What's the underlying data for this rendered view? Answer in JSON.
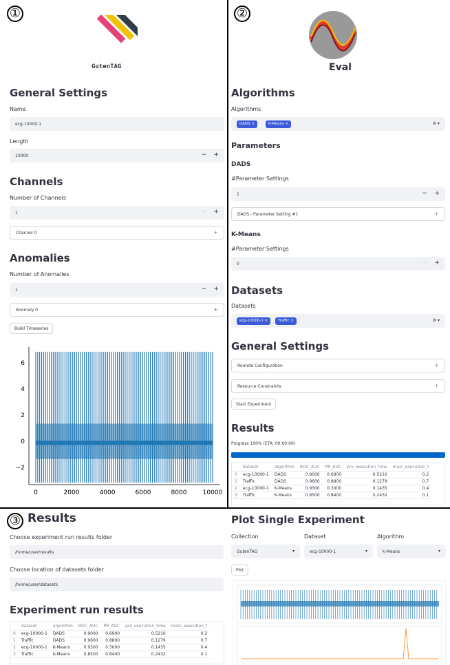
{
  "panel1": {
    "number": "①",
    "logo_text": "GutenTAG",
    "general_settings": "General Settings",
    "name_label": "Name",
    "name_value": "ecg-10000-1",
    "length_label": "Length",
    "length_value": "10000",
    "channels_heading": "Channels",
    "num_channels_label": "Number of Channels",
    "num_channels_value": "1",
    "channel0": "Channel 0",
    "anomalies_heading": "Anomalies",
    "num_anomalies_label": "Number of Anomalies",
    "num_anomalies_value": "1",
    "anomaly0": "Anomaly 0",
    "build_button": "Build Timeseries",
    "plot_y_ticks": [
      "6",
      "4",
      "2",
      "0",
      "−2"
    ],
    "plot_x_ticks": [
      "0",
      "2000",
      "4000",
      "6000",
      "8000",
      "10000"
    ]
  },
  "panel2": {
    "number": "②",
    "logo_text": "Eval",
    "algorithms_heading": "Algorithms",
    "algorithms_label": "Algorithms",
    "algorithm_tags": [
      "DADS",
      "K-Means"
    ],
    "parameters_heading": "Parameters",
    "dads_heading": "DADS",
    "dads_param_label": "#Parameter Settings",
    "dads_param_value": "1",
    "dads_param_expander": "DADS - Parameter Setting #1",
    "kmeans_heading": "K-Means",
    "kmeans_param_label": "#Parameter Settings",
    "kmeans_param_value": "0",
    "datasets_heading": "Datasets",
    "datasets_label": "Datasets",
    "dataset_tags": [
      "ecg-10000-1",
      "Traffic"
    ],
    "general_settings": "General Settings",
    "remote_config": "Remote Configuration",
    "resource_constraints": "Resource Constraints",
    "start_button": "Start Experiment",
    "results_heading": "Results",
    "progress_text": "Progress 100% (ETA: 00:00:00)",
    "progress_fraction": 1.0
  },
  "results_table": {
    "columns": [
      "",
      "dataset",
      "algorithm",
      "ROC_AUC",
      "PR_AUC",
      "pre_execution_time",
      "main_execution_t"
    ],
    "rows": [
      [
        "0",
        "ecg-10000-1",
        "DADS",
        "0.9000",
        "0.6900",
        "0.5210",
        "0.2"
      ],
      [
        "1",
        "Traffic",
        "DADS",
        "0.9600",
        "0.8800",
        "0.1279",
        "0.7"
      ],
      [
        "2",
        "ecg-10000-1",
        "K-Means",
        "0.9300",
        "0.3000",
        "0.1435",
        "0.4"
      ],
      [
        "3",
        "Traffic",
        "K-Means",
        "0.8500",
        "0.8400",
        "0.2432",
        "0.1"
      ]
    ]
  },
  "panel3": {
    "number": "③",
    "results_heading": "Results",
    "folder_label": "Choose experiment run results folder",
    "folder_value": "/home/user/results",
    "datasets_label": "Choose location of datasets folder",
    "datasets_value": "/home/user/datasets",
    "exp_results_heading": "Experiment run results"
  },
  "panel4": {
    "heading": "Plot Single Experiment",
    "collection_label": "Collection",
    "collection_value": "GutenTAG",
    "dataset_label": "Dataset",
    "dataset_value": "ecg-10000-1",
    "algorithm_label": "Algorithm",
    "algorithm_value": "k-Means",
    "plot_button": "Plot"
  },
  "colors": {
    "accent": "#1f77b4",
    "tag": "#3b5bdb",
    "progress": "#0068c9",
    "input_bg": "#f0f2f6"
  }
}
